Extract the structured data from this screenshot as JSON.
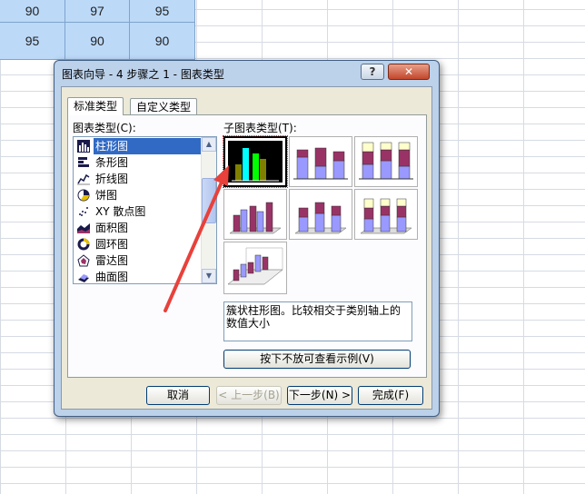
{
  "sheet": {
    "row1": [
      "90",
      "97",
      "95"
    ],
    "row2": [
      "95",
      "90",
      "90"
    ]
  },
  "dialog": {
    "title": "图表向导 - 4 步骤之 1 - 图表类型",
    "help_label": "?",
    "close_label": "✕",
    "tabs": [
      "标准类型",
      "自定义类型"
    ],
    "chart_types_label": "图表类型(C):",
    "chart_types": [
      {
        "label": "柱形图",
        "icon": "column-chart-icon"
      },
      {
        "label": "条形图",
        "icon": "bar-chart-icon"
      },
      {
        "label": "折线图",
        "icon": "line-chart-icon"
      },
      {
        "label": "饼图",
        "icon": "pie-chart-icon"
      },
      {
        "label": "XY 散点图",
        "icon": "scatter-chart-icon"
      },
      {
        "label": "面积图",
        "icon": "area-chart-icon"
      },
      {
        "label": "圆环图",
        "icon": "doughnut-chart-icon"
      },
      {
        "label": "雷达图",
        "icon": "radar-chart-icon"
      },
      {
        "label": "曲面图",
        "icon": "surface-chart-icon"
      }
    ],
    "selected_type_index": 0,
    "subtypes_label": "子图表类型(T):",
    "description": "簇状柱形图。比较相交于类别轴上的数值大小",
    "preview_button": "按下不放可查看示例(V)",
    "buttons": {
      "cancel": "取消",
      "back": "< 上一步(B)",
      "next": "下一步(N) >",
      "finish": "完成(F)"
    }
  },
  "colors": {
    "selection": "#316ac5",
    "series_a": "#9999ff",
    "series_b": "#993366",
    "series_c": "#ffffcc",
    "cell_fill": "#bcd9f8",
    "annotation_arrow": "#e8413b"
  }
}
